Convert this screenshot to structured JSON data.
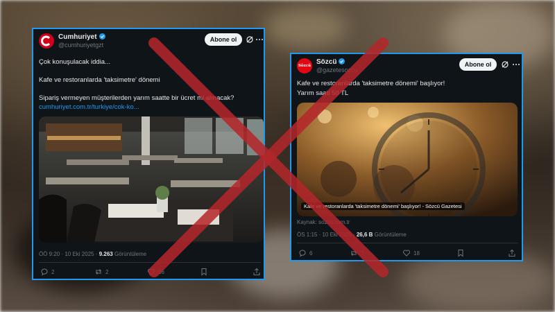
{
  "left_tweet": {
    "name": "Cumhuriyet",
    "handle": "@cumhuriyetgzt",
    "follow_label": "Abone ol",
    "line1": "Çok konuşulacak iddia...",
    "line2": "Kafe ve restoranlarda 'taksimetre' dönemi",
    "line3": "Sipariş vermeyen müşterilerden yarım saatte bir ücret mi alınacak?",
    "link": "cumhuriyet.com.tr/turkiye/cok-ko...",
    "time": "ÖÖ 9:20 · 10 Eki 2025 · ",
    "views": "9.263",
    "views_label": " Görüntüleme",
    "replies": "2",
    "reposts": "2",
    "likes": "16"
  },
  "right_tweet": {
    "avatar_text": "Sözcü",
    "name": "Sözcü",
    "handle": "@gazetesozcu",
    "follow_label": "Abone ol",
    "line1": "Kafe ve restoranlarda 'taksimetre dönemi' başlıyor!",
    "line2": "Yarım saati 50 TL",
    "card_caption": "Kafe ve restoranlarda 'taksimetre dönemi' başlıyor! - Sözcü Gazetesi",
    "source": "Kaynak: sozcu.com.tr",
    "time": "ÖS 1:15 · 10 Eki 2025 · ",
    "views": "26,6 B",
    "views_label": " Görüntüleme",
    "replies": "6",
    "reposts": "7",
    "likes": "18"
  },
  "colors": {
    "accent": "#1d9bf0",
    "cross": "#b5262a",
    "cumhuriyet_red": "#d0021b",
    "sozcu_red": "#e30613"
  }
}
